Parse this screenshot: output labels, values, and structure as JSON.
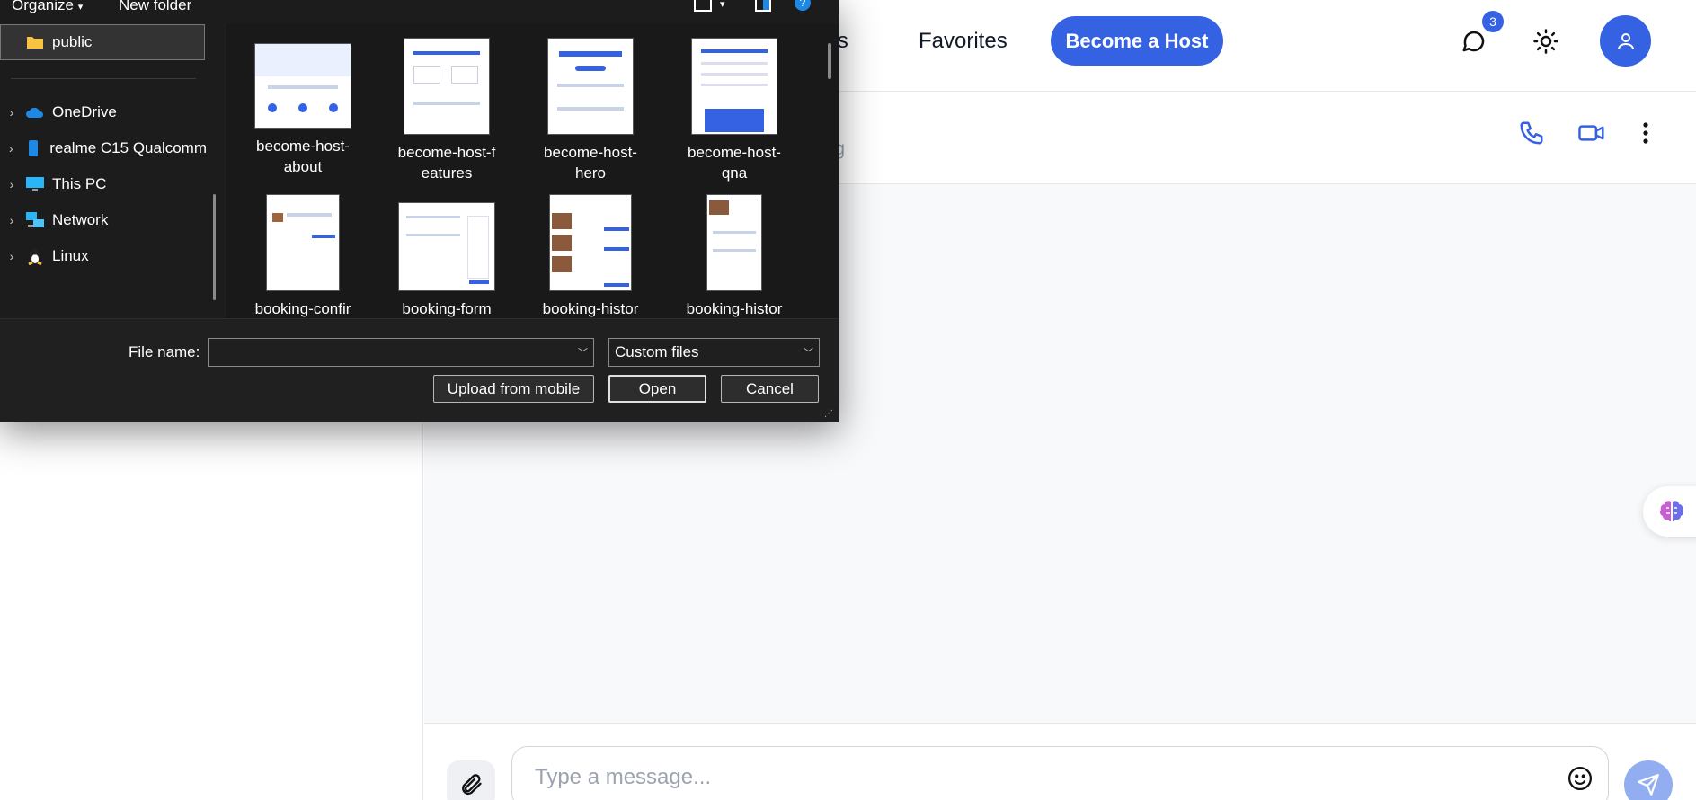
{
  "app": {
    "nav_partial": "ngs",
    "nav_favorites": "Favorites",
    "become_host": "Become a Host",
    "messages_badge": "3",
    "chat_status_partial": "ing",
    "message_placeholder": "Type a message..."
  },
  "dialog": {
    "toolbar": {
      "organize": "Organize",
      "new_folder": "New folder"
    },
    "nav": [
      {
        "label": "public",
        "icon": "folder-icon",
        "selected": true
      },
      {
        "label": "OneDrive",
        "icon": "cloud-icon"
      },
      {
        "label": "realme C15 Qualcomm",
        "icon": "phone-icon"
      },
      {
        "label": "This PC",
        "icon": "pc-icon"
      },
      {
        "label": "Network",
        "icon": "network-icon"
      },
      {
        "label": "Linux",
        "icon": "linux-icon"
      }
    ],
    "files": [
      {
        "line1": "become-host-",
        "line2": "about"
      },
      {
        "line1": "become-host-f",
        "line2": "eatures"
      },
      {
        "line1": "become-host-",
        "line2": "hero"
      },
      {
        "line1": "become-host-",
        "line2": "qna"
      },
      {
        "line1": "booking-confir",
        "line2": ""
      },
      {
        "line1": "booking-form",
        "line2": ""
      },
      {
        "line1": "booking-histor",
        "line2": ""
      },
      {
        "line1": "booking-histor",
        "line2": ""
      }
    ],
    "file_name_label": "File name:",
    "file_name_value": "",
    "file_type": "Custom files",
    "upload_mobile": "Upload from mobile",
    "open": "Open",
    "cancel": "Cancel"
  },
  "colors": {
    "accent": "#3561e3",
    "dialog_bg": "#202020"
  }
}
